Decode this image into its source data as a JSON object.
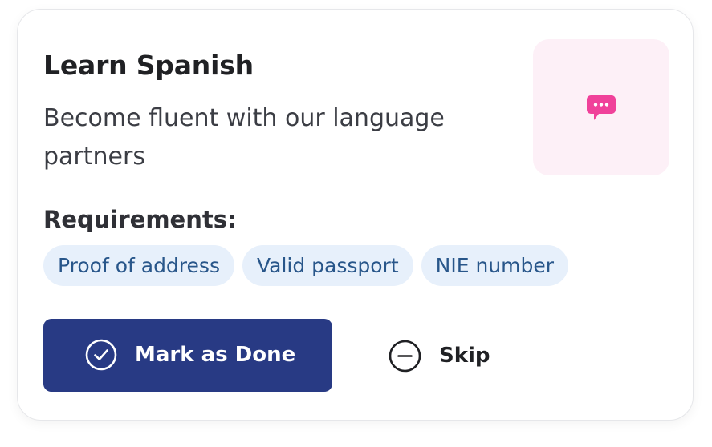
{
  "card": {
    "title": "Learn Spanish",
    "description": "Become fluent with our language partners",
    "icon": "chat-bubble-icon",
    "icon_color": "#f0419a",
    "icon_background": "#fdf0f7"
  },
  "requirements": {
    "heading": "Requirements:",
    "items": [
      "Proof of address",
      "Valid passport",
      "NIE number"
    ],
    "chip_background": "#e7f0fb",
    "chip_text_color": "#28568a"
  },
  "actions": {
    "done_label": "Mark as Done",
    "done_icon": "check-circle-icon",
    "done_color": "#283a84",
    "skip_label": "Skip",
    "skip_icon": "minus-circle-icon"
  }
}
